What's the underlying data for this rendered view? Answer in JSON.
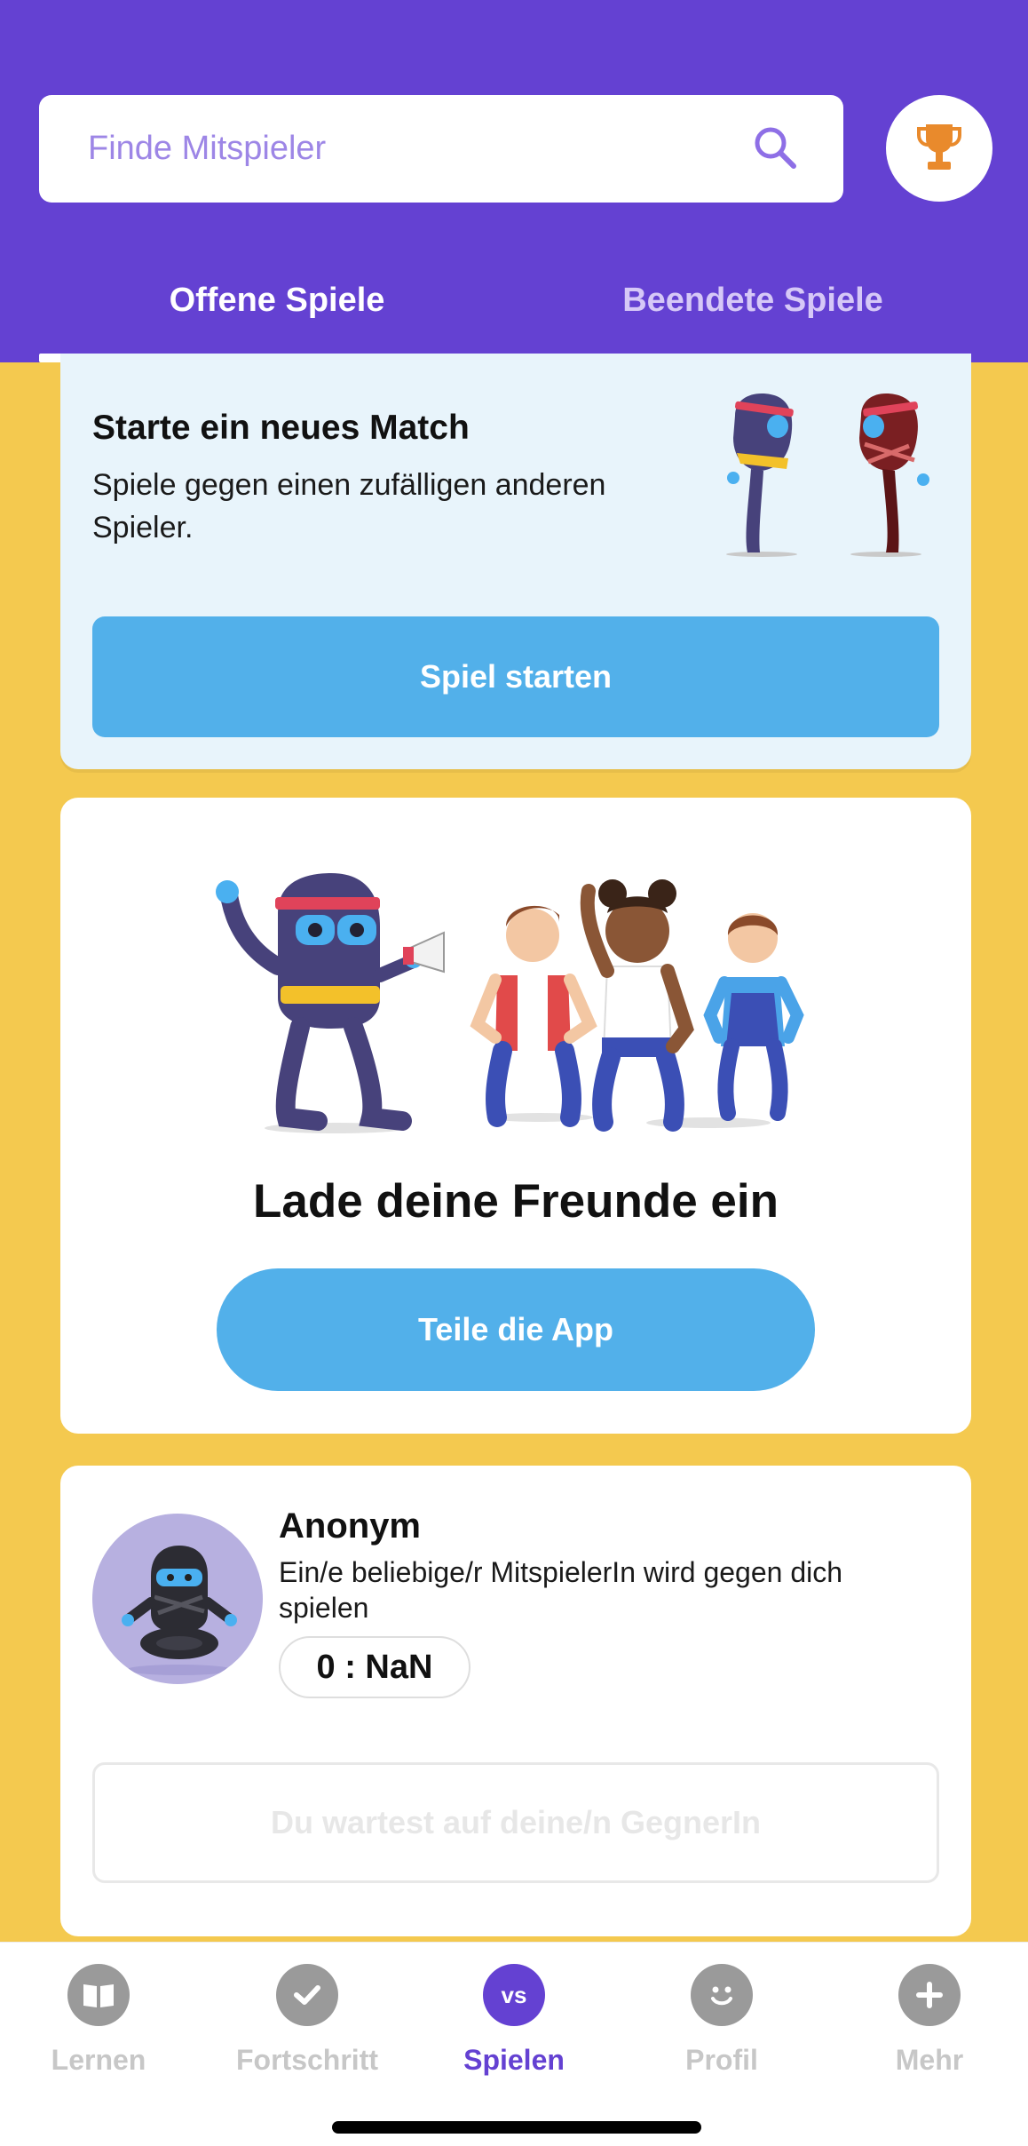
{
  "header": {
    "search_placeholder": "Finde Mitspieler",
    "tabs": [
      {
        "label": "Offene Spiele",
        "active": true
      },
      {
        "label": "Beendete Spiele",
        "active": false
      }
    ]
  },
  "new_match": {
    "title": "Starte ein neues Match",
    "description": "Spiele gegen einen zufälligen anderen Spieler.",
    "button_label": "Spiel starten"
  },
  "invite": {
    "title": "Lade deine Freunde ein",
    "button_label": "Teile die App"
  },
  "opponent": {
    "name": "Anonym",
    "description": "Ein/e beliebige/r MitspielerIn wird gegen dich spielen",
    "score": "0 : NaN",
    "waiting_label": "Du wartest auf deine/n GegnerIn"
  },
  "nav": {
    "items": [
      {
        "label": "Lernen",
        "icon": "book-icon",
        "active": false
      },
      {
        "label": "Fortschritt",
        "icon": "check-icon",
        "active": false
      },
      {
        "label": "Spielen",
        "icon": "vs-icon",
        "icon_text": "vs",
        "active": true
      },
      {
        "label": "Profil",
        "icon": "smiley-icon",
        "active": false
      },
      {
        "label": "Mehr",
        "icon": "plus-icon",
        "active": false
      }
    ]
  },
  "colors": {
    "header_purple": "#6441d2",
    "background_yellow": "#f4c94f",
    "button_blue": "#52b0ea",
    "trophy_orange": "#e98a2c"
  }
}
